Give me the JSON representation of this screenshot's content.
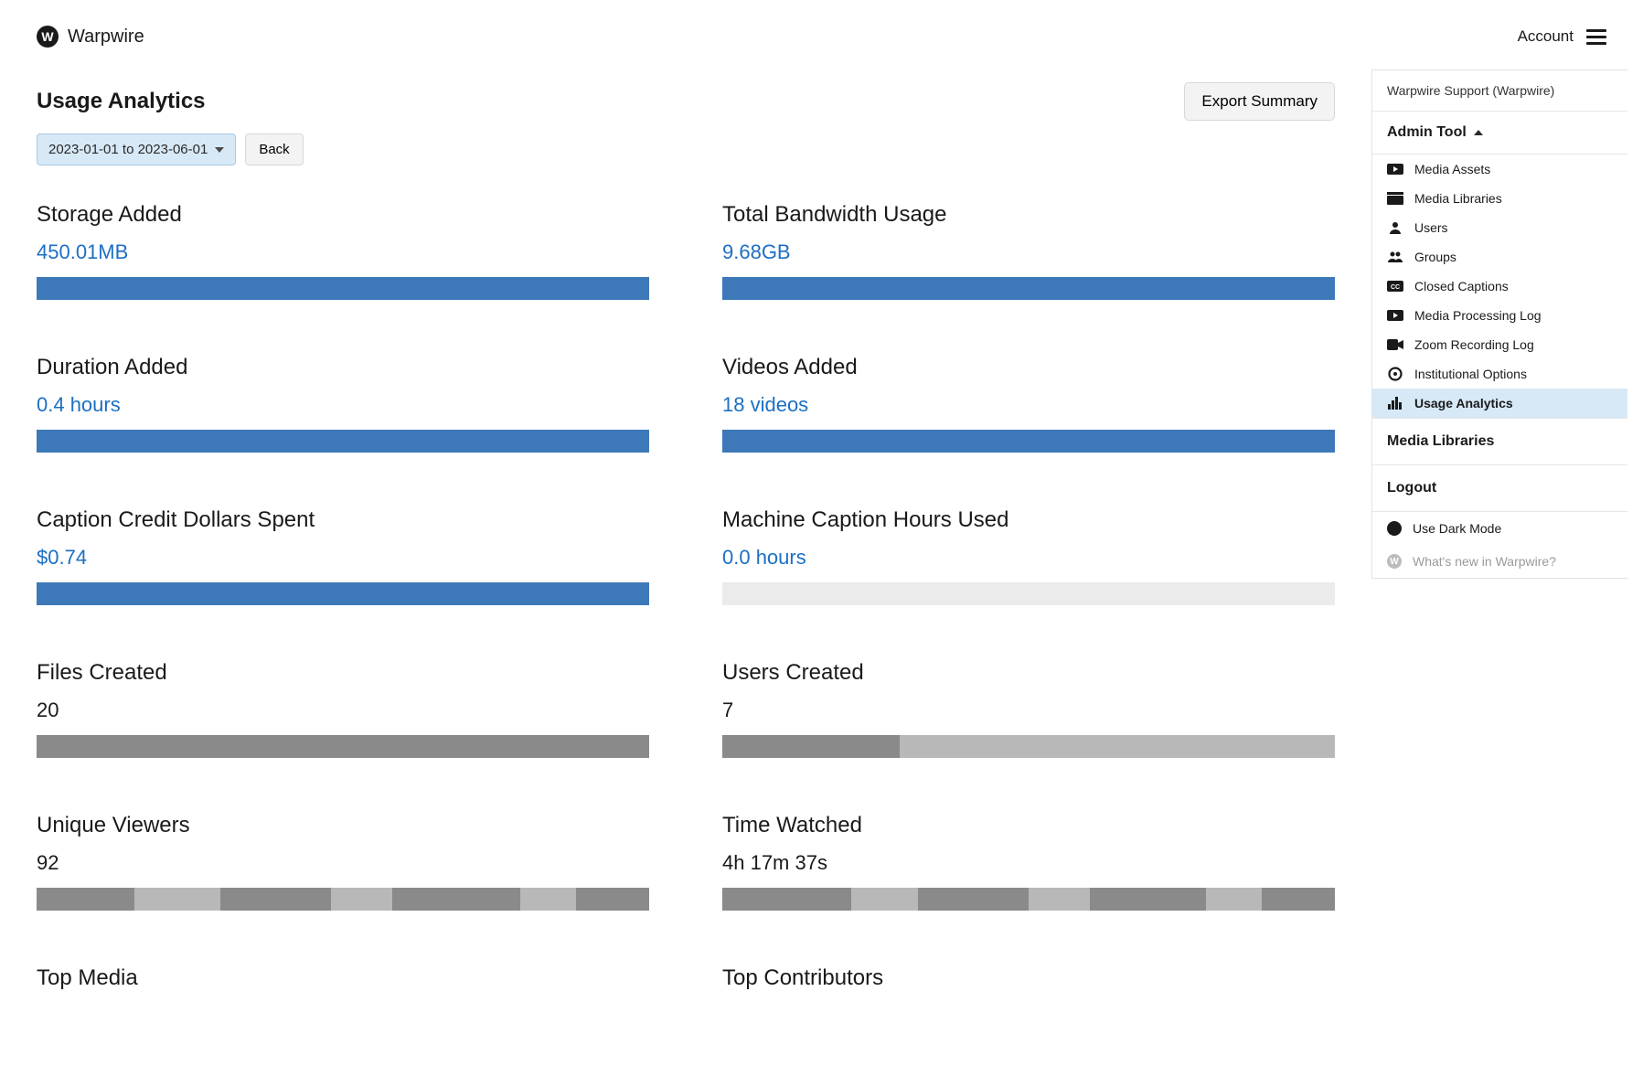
{
  "brand": {
    "name": "Warpwire",
    "logo_letter": "W"
  },
  "topbar": {
    "account_label": "Account"
  },
  "page": {
    "title": "Usage Analytics",
    "export_label": "Export Summary",
    "date_range_label": "2023-01-01 to 2023-06-01",
    "back_label": "Back"
  },
  "metrics": [
    {
      "title": "Storage Added",
      "value": "450.01MB",
      "link": true,
      "bar_style": "blue",
      "fill_pct": 100
    },
    {
      "title": "Total Bandwidth Usage",
      "value": "9.68GB",
      "link": true,
      "bar_style": "blue",
      "fill_pct": 100
    },
    {
      "title": "Duration Added",
      "value": "0.4 hours",
      "link": true,
      "bar_style": "blue",
      "fill_pct": 100
    },
    {
      "title": "Videos Added",
      "value": "18 videos",
      "link": true,
      "bar_style": "blue",
      "fill_pct": 100
    },
    {
      "title": "Caption Credit Dollars Spent",
      "value": "$0.74",
      "link": true,
      "bar_style": "blue",
      "fill_pct": 100
    },
    {
      "title": "Machine Caption Hours Used",
      "value": "0.0 hours",
      "link": true,
      "bar_style": "blue",
      "fill_pct": 0
    },
    {
      "title": "Files Created",
      "value": "20",
      "link": false,
      "bar_style": "gray",
      "fill_pct": 100
    },
    {
      "title": "Users Created",
      "value": "7",
      "link": false,
      "bar_style": "gray-segments",
      "segments": [
        29,
        71
      ]
    },
    {
      "title": "Unique Viewers",
      "value": "92",
      "link": false,
      "bar_style": "alt-segments",
      "segments": [
        16,
        14,
        18,
        10,
        21,
        9,
        12
      ]
    },
    {
      "title": "Time Watched",
      "value": "4h 17m 37s",
      "link": false,
      "bar_style": "alt-segments",
      "segments": [
        21,
        11,
        18,
        10,
        19,
        9,
        12
      ]
    }
  ],
  "bottom_sections": [
    {
      "title": "Top Media"
    },
    {
      "title": "Top Contributors"
    }
  ],
  "sidebar": {
    "user_line": "Warpwire Support (Warpwire)",
    "admin_tool_label": "Admin Tool",
    "items": [
      {
        "label": "Media Assets",
        "icon": "play-rect"
      },
      {
        "label": "Media Libraries",
        "icon": "stack"
      },
      {
        "label": "Users",
        "icon": "person"
      },
      {
        "label": "Groups",
        "icon": "people"
      },
      {
        "label": "Closed Captions",
        "icon": "cc"
      },
      {
        "label": "Media Processing Log",
        "icon": "play-rect"
      },
      {
        "label": "Zoom Recording Log",
        "icon": "camera"
      },
      {
        "label": "Institutional Options",
        "icon": "gear"
      },
      {
        "label": "Usage Analytics",
        "icon": "bars",
        "active": true
      }
    ],
    "media_libraries_label": "Media Libraries",
    "logout_label": "Logout",
    "dark_mode_label": "Use Dark Mode",
    "whats_new_label": "What's new in Warpwire?"
  }
}
